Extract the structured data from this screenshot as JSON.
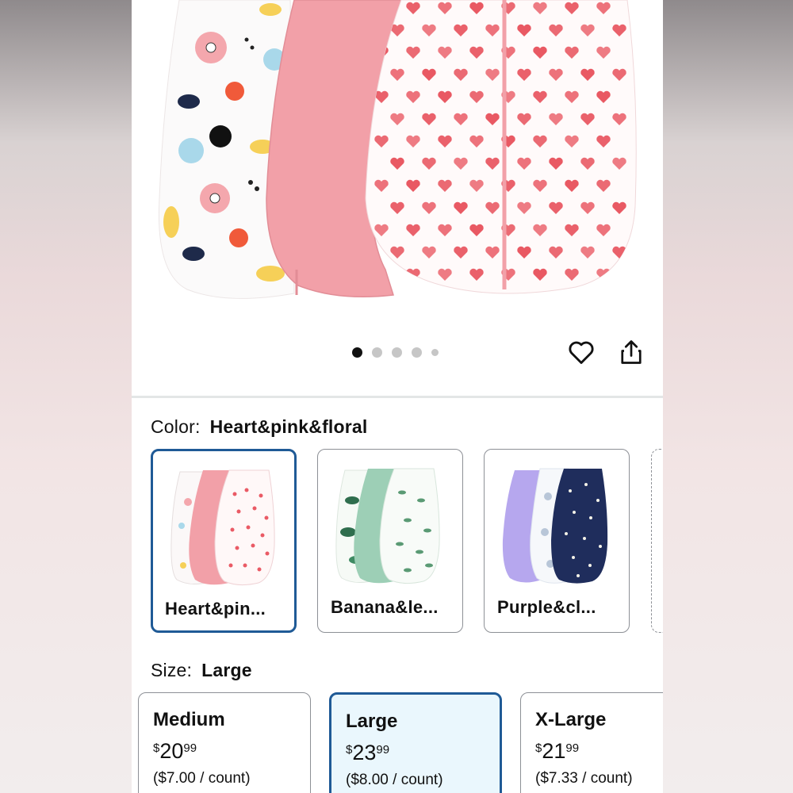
{
  "product": {
    "image_carousel": {
      "total_images": 5,
      "active_index": 0
    }
  },
  "color_selector": {
    "label": "Color:",
    "selected_value": "Heart&pink&floral",
    "options": [
      {
        "name": "Heart&pin...",
        "selected": true
      },
      {
        "name": "Banana&le...",
        "selected": false
      },
      {
        "name": "Purple&cl...",
        "selected": false
      }
    ]
  },
  "size_selector": {
    "label": "Size:",
    "selected_value": "Large",
    "options": [
      {
        "name": "Medium",
        "currency": "$",
        "whole": "20",
        "fraction": "99",
        "unit_price": "($7.00 / count)",
        "selected": false
      },
      {
        "name": "Large",
        "currency": "$",
        "whole": "23",
        "fraction": "99",
        "unit_price": "($8.00 / count)",
        "selected": true
      },
      {
        "name": "X-Large",
        "currency": "$",
        "whole": "21",
        "fraction": "99",
        "unit_price": "($7.33 / count)",
        "selected": false
      }
    ]
  },
  "icons": {
    "favorite": "heart-outline-icon",
    "share": "share-icon"
  },
  "colors": {
    "selected_border": "#1f5a96",
    "selected_bg": "#eaf7fd",
    "pink": "#f2a0a8",
    "heart_red": "#e8505b"
  }
}
